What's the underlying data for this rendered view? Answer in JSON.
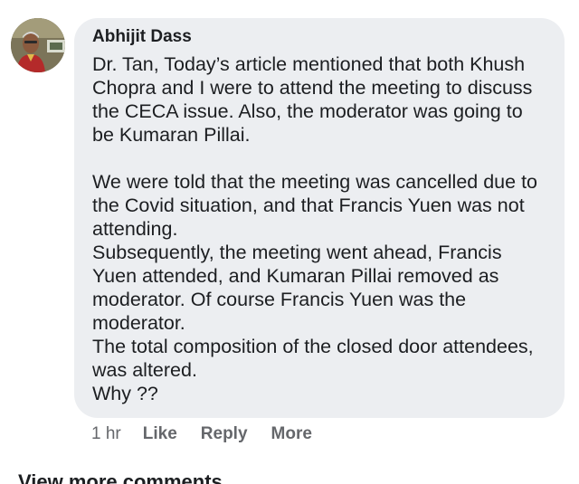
{
  "comment": {
    "author": "Abhijit Dass",
    "paragraphs": [
      "Dr. Tan, Today’s article mentioned that both Khush Chopra and I were to attend the meeting to discuss the CECA issue. Also, the moderator was going to be Kumaran Pillai.",
      "We were told that the meeting was cancelled due to the Covid situation, and that Francis Yuen was not attending.",
      "Subsequently, the meeting went ahead, Francis Yuen attended, and Kumaran Pillai removed as moderator. Of course Francis Yuen was the moderator.",
      "The total composition of the closed door attendees, was altered.",
      "Why ??"
    ],
    "timestamp": "1 hr",
    "actions": {
      "like": "Like",
      "reply": "Reply",
      "more": "More"
    }
  },
  "footer": {
    "view_more": "View more comments"
  },
  "colors": {
    "bubble_bg": "#eceef1",
    "text": "#1c1e21",
    "meta": "#65676b"
  }
}
